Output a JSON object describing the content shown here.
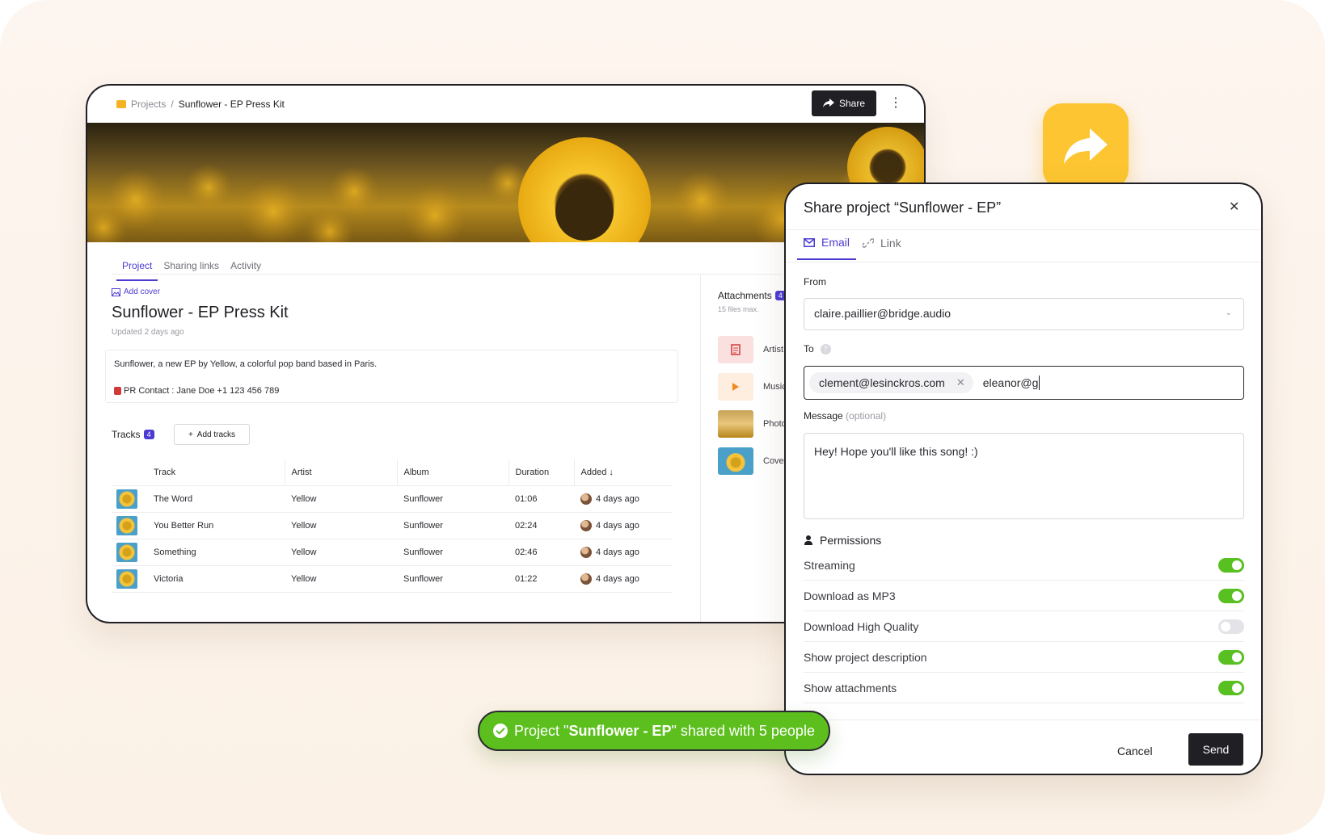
{
  "project_window": {
    "breadcrumb": {
      "root": "Projects",
      "separator": "/",
      "current": "Sunflower - EP Press Kit"
    },
    "share_button": "Share",
    "tabs": [
      {
        "label": "Project",
        "active": true
      },
      {
        "label": "Sharing links",
        "active": false
      },
      {
        "label": "Activity",
        "active": false
      }
    ],
    "add_cover": "Add cover",
    "title": "Sunflower - EP Press Kit",
    "updated": "Updated 2 days ago",
    "description": {
      "line1": "Sunflower, a new EP by Yellow, a colorful pop band based in Paris.",
      "line2": "PR Contact : Jane Doe +1 123 456 789"
    },
    "tracks": {
      "label": "Tracks",
      "count": "4",
      "add_button": "Add tracks",
      "columns": [
        "Track",
        "Artist",
        "Album",
        "Duration",
        "Added"
      ],
      "rows": [
        {
          "track": "The Word",
          "artist": "Yellow",
          "album": "Sunflower",
          "duration": "01:06",
          "added": "4 days ago"
        },
        {
          "track": "You Better Run",
          "artist": "Yellow",
          "album": "Sunflower",
          "duration": "02:24",
          "added": "4 days ago"
        },
        {
          "track": "Something",
          "artist": "Yellow",
          "album": "Sunflower",
          "duration": "02:46",
          "added": "4 days ago"
        },
        {
          "track": "Victoria",
          "artist": "Yellow",
          "album": "Sunflower",
          "duration": "01:22",
          "added": "4 days ago"
        }
      ]
    },
    "attachments": {
      "title": "Attachments",
      "count": "4",
      "subtitle": "15 files max.",
      "items": [
        {
          "label": "Artist",
          "icon": "document-icon",
          "color": "#fbe0e0"
        },
        {
          "label": "Music",
          "icon": "play-icon",
          "color": "#fdeee0"
        },
        {
          "label": "Photo",
          "icon": "photo-icon",
          "color": "#e8c67a"
        },
        {
          "label": "Cover",
          "icon": "cover-icon",
          "color": "#4aa0c8"
        }
      ]
    }
  },
  "share_dialog": {
    "title": "Share project “Sunflower - EP”",
    "tabs": [
      {
        "label": "Email",
        "active": true
      },
      {
        "label": "Link",
        "active": false
      }
    ],
    "from_label": "From",
    "from_value": "claire.paillier@bridge.audio",
    "to_label": "To",
    "to_chip": "clement@lesinckros.com",
    "to_typing": "eleanor@g",
    "message_label": "Message",
    "message_optional": "(optional)",
    "message_value": "Hey! Hope you'll like this song! :)",
    "permissions_title": "Permissions",
    "permissions": [
      {
        "label": "Streaming",
        "enabled": true
      },
      {
        "label": "Download as MP3",
        "enabled": true
      },
      {
        "label": "Download High Quality",
        "enabled": false
      },
      {
        "label": "Show project description",
        "enabled": true
      },
      {
        "label": "Show attachments",
        "enabled": true
      }
    ],
    "cancel": "Cancel",
    "send": "Send"
  },
  "toast": {
    "prefix": "Project \"",
    "project": "Sunflower - EP",
    "suffix": "\" shared with 5 people"
  },
  "colors": {
    "accent": "#4b3bd2",
    "success": "#5cbf1e",
    "share_icon_bg": "#fcc531",
    "dark": "#1f1f24"
  }
}
